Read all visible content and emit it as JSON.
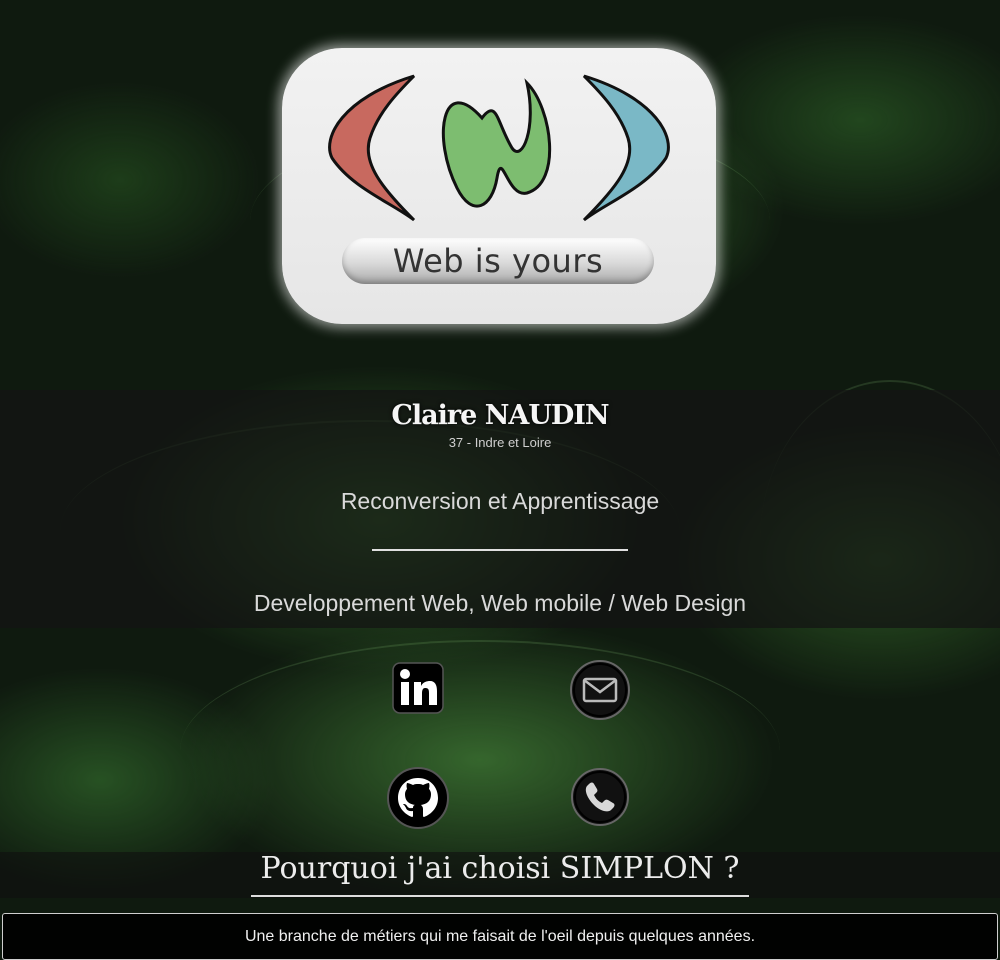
{
  "logo": {
    "tagline": "Web is yours",
    "colors": {
      "left_bracket": "#c8695f",
      "center_n": "#7dbd70",
      "right_bracket": "#7ab8c6",
      "card": "#eeeeee"
    }
  },
  "profile": {
    "name": "Claire NAUDIN",
    "location": "37 - Indre et Loire",
    "subtitle": "Reconversion et Apprentissage",
    "specialty": "Developpement Web, Web mobile / Web Design"
  },
  "social": {
    "items": [
      {
        "icon": "linkedin-icon"
      },
      {
        "icon": "mail-icon"
      },
      {
        "icon": "github-icon"
      },
      {
        "icon": "phone-icon"
      }
    ]
  },
  "section": {
    "title": "Pourquoi j'ai choisi SIMPLON ?",
    "text": "Une branche de métiers qui me faisait de l'oeil depuis quelques années."
  }
}
